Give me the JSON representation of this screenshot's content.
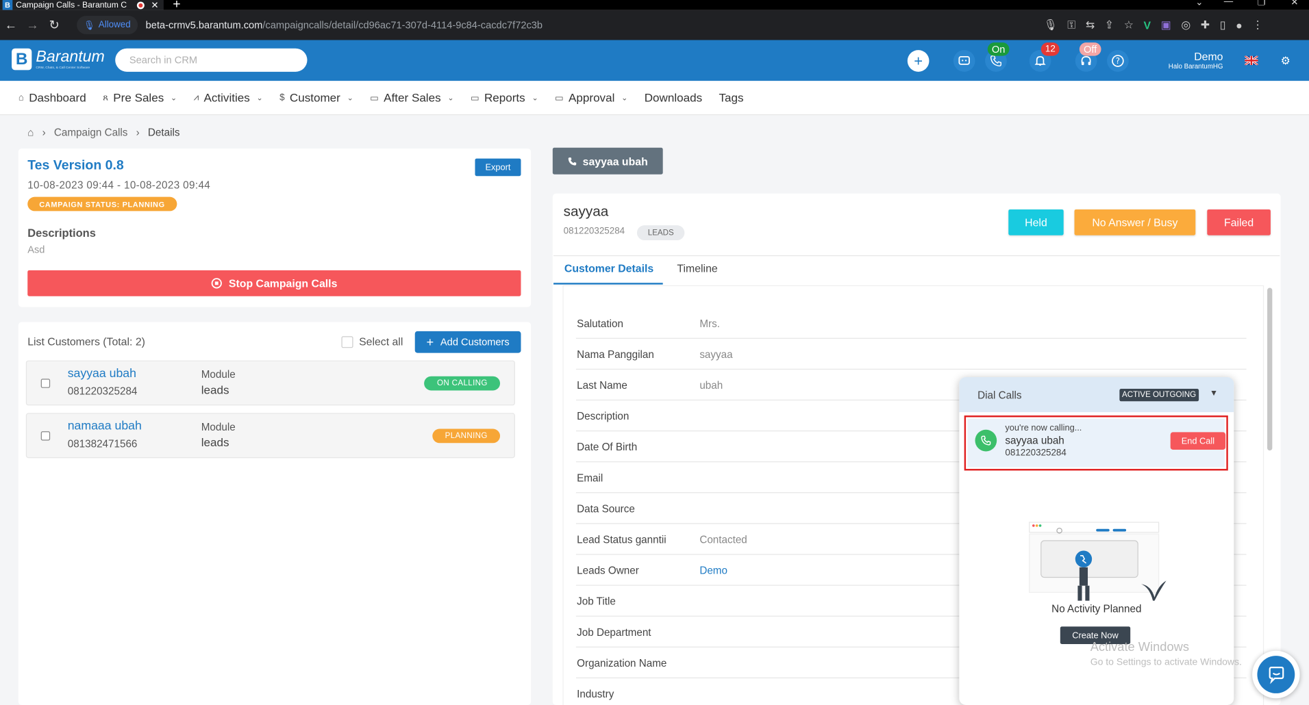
{
  "browser": {
    "tab_title": "Campaign Calls - Barantum C",
    "tab_favicon": "B",
    "new_tab": "+",
    "permission_label": "Allowed",
    "url_host": "beta-crmv5.barantum.com",
    "url_path": "/campaigncalls/detail/cd96ac71-307d-4114-9c84-cacdc7f72c3b"
  },
  "app": {
    "logo_mark": "B",
    "logo_name": "Barantum",
    "logo_tagline": "CRM, Chats, & Call Center Software",
    "search_placeholder": "Search in CRM",
    "call_toggle": "On",
    "notification_count": "12",
    "agent_toggle": "Off",
    "user_name": "Demo",
    "user_greeting": "Halo BarantumHG",
    "accent_color": "#1f7bc4"
  },
  "menu": [
    {
      "label": "Dashboard",
      "icon": "home-icon",
      "dropdown": false
    },
    {
      "label": "Pre Sales",
      "icon": "users-icon",
      "dropdown": true
    },
    {
      "label": "Activities",
      "icon": "activity-icon",
      "dropdown": true
    },
    {
      "label": "Customer",
      "icon": "dollar-icon",
      "dropdown": true
    },
    {
      "label": "After Sales",
      "icon": "folder-icon",
      "dropdown": true
    },
    {
      "label": "Reports",
      "icon": "folder-icon",
      "dropdown": true
    },
    {
      "label": "Approval",
      "icon": "folder-icon",
      "dropdown": true
    },
    {
      "label": "Downloads",
      "icon": "",
      "dropdown": false
    },
    {
      "label": "Tags",
      "icon": "",
      "dropdown": false
    }
  ],
  "breadcrumb": {
    "sep": "›",
    "parent": "Campaign Calls",
    "current": "Details"
  },
  "campaign": {
    "title": "Tes Version 0.8",
    "dates": "10-08-2023 09:44 - 10-08-2023 09:44",
    "status_label": "CAMPAIGN STATUS:",
    "status_value": "PLANNING",
    "export_label": "Export",
    "descriptions_label": "Descriptions",
    "descriptions_value": "Asd",
    "stop_label": "Stop Campaign Calls"
  },
  "customers": {
    "title": "List Customers (Total: 2)",
    "select_all": "Select all",
    "add_label": "Add Customers",
    "rows": [
      {
        "name": "sayyaa ubah",
        "phone": "081220325284",
        "module_label": "Module",
        "module_value": "leads",
        "status": "ON CALLING",
        "status_color": "#3cc37a"
      },
      {
        "name": "namaaa ubah",
        "phone": "081382471566",
        "module_label": "Module",
        "module_value": "leads",
        "status": "PLANNING",
        "status_color": "#f7a636"
      }
    ]
  },
  "active_call_tab": "sayyaa ubah",
  "record": {
    "name": "sayyaa",
    "phone": "081220325284",
    "module_badge": "LEADS",
    "outcome_buttons": [
      {
        "label": "Held",
        "color": "#19cbe0"
      },
      {
        "label": "No Answer / Busy",
        "color": "#fbab3c"
      },
      {
        "label": "Failed",
        "color": "#f6575b"
      }
    ],
    "tabs": [
      "Customer Details",
      "Timeline"
    ],
    "fields": [
      {
        "label": "Salutation",
        "value": "Mrs."
      },
      {
        "label": "Nama Panggilan",
        "value": "sayyaa"
      },
      {
        "label": "Last Name",
        "value": "ubah"
      },
      {
        "label": "Description",
        "value": ""
      },
      {
        "label": "Date Of Birth",
        "value": ""
      },
      {
        "label": "Email",
        "value": ""
      },
      {
        "label": "Data Source",
        "value": ""
      },
      {
        "label": "Lead Status ganntii",
        "value": "Contacted"
      },
      {
        "label": "Leads Owner",
        "value": "Demo"
      },
      {
        "label": "Job Title",
        "value": ""
      },
      {
        "label": "Job Department",
        "value": ""
      },
      {
        "label": "Organization Name",
        "value": ""
      },
      {
        "label": "Industry",
        "value": ""
      }
    ]
  },
  "dial": {
    "title": "Dial Calls",
    "status": "ACTIVE OUTGOING",
    "calling_text": "you're now calling...",
    "callee_name": "sayyaa ubah",
    "callee_phone": "081220325284",
    "end_label": "End Call",
    "empty_text": "No Activity Planned",
    "create_label": "Create Now"
  },
  "os_watermark": {
    "line1": "Activate Windows",
    "line2": "Go to Settings to activate Windows."
  }
}
